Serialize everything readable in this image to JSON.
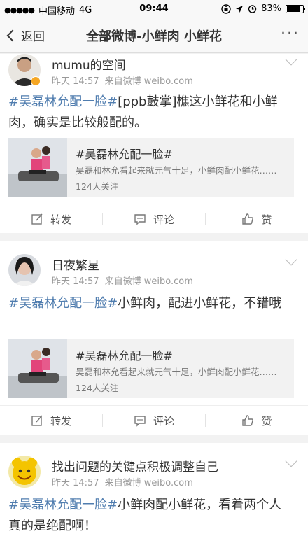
{
  "status_bar": {
    "signal": "●●●●●",
    "carrier": "中国移动",
    "network": "4G",
    "time": "09:44",
    "battery": "83%"
  },
  "nav": {
    "back_label": "返回",
    "title": "全部微博-小鲜肉 小鲜花",
    "more_label": "···"
  },
  "posts": [
    {
      "user": "mumu的空间",
      "time": "昨天 14:57",
      "source": "来自微博 weibo.com",
      "topic": "#吴磊林允配一脸#",
      "text": "[ppb鼓掌]樵这小鲜花和小鲜肉，确实是比较般配的。",
      "share_title": "#吴磊林允配一脸#",
      "share_desc": "吴磊和林允看起来就元气十足，小鲜肉配小鲜花……",
      "share_follow": "124人关注",
      "repost": "转发",
      "comment": "评论",
      "like": "赞"
    },
    {
      "user": "日夜繁星",
      "time": "昨天 14:57",
      "source": "来自微博 weibo.com",
      "topic": "#吴磊林允配一脸#",
      "text": "小鲜肉，配进小鲜花，不错哦",
      "share_title": "#吴磊林允配一脸#",
      "share_desc": "吴磊和林允看起来就元气十足，小鲜肉配小鲜花……",
      "share_follow": "124人关注",
      "repost": "转发",
      "comment": "评论",
      "like": "赞"
    },
    {
      "user": "找出问题的关键点积极调整自己",
      "time": "昨天 14:57",
      "source": "来自微博 weibo.com",
      "topic": "#吴磊林允配一脸#",
      "text": "小鲜肉配小鲜花，看着两个人真的是绝配啊！"
    }
  ],
  "colors": {
    "topic": "#507daf",
    "background": "#f2f2f2"
  }
}
